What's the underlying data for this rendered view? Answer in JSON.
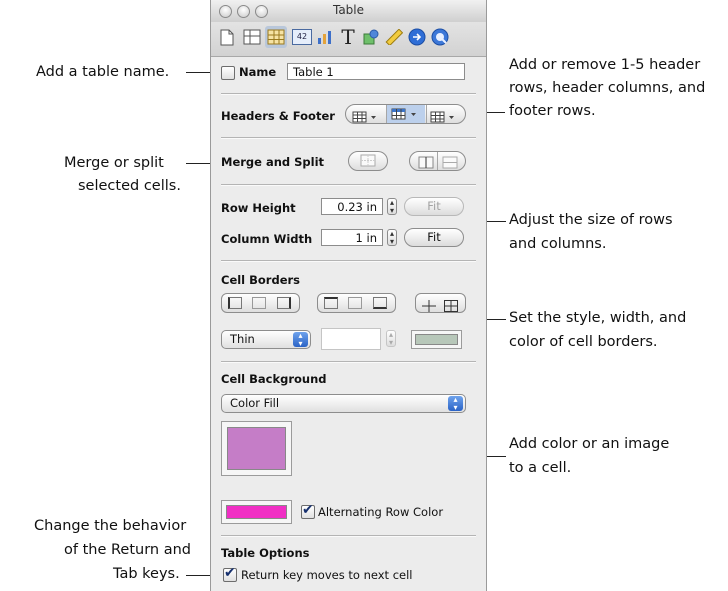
{
  "window": {
    "title": "Table"
  },
  "toolbar": {
    "icons": [
      "document-icon",
      "layout-icon",
      "table-icon",
      "graph-icon",
      "chart-icon",
      "text-icon",
      "shape-icon",
      "metrics-icon",
      "hyperlink-icon",
      "quicktime-icon"
    ],
    "graph_label": "42",
    "text_label": "T"
  },
  "name_row": {
    "label": "Name",
    "value": "Table 1"
  },
  "headers_footer": {
    "label": "Headers & Footer"
  },
  "merge_split": {
    "label": "Merge and Split"
  },
  "row_height": {
    "label": "Row Height",
    "value": "0.23 in",
    "fit_label": "Fit"
  },
  "column_width": {
    "label": "Column Width",
    "value": "1 in",
    "fit_label": "Fit"
  },
  "cell_borders": {
    "label": "Cell Borders",
    "style_value": "Thin",
    "width_value": "",
    "color": "#b7c7b9"
  },
  "cell_background": {
    "label": "Cell Background",
    "fill_value": "Color Fill",
    "fill_color": "#c57dc7",
    "alt_row_color": "#f02fc4",
    "alt_row_label": "Alternating Row Color"
  },
  "table_options": {
    "label": "Table Options",
    "return_key_label": "Return key moves to next cell"
  },
  "callouts": {
    "name": "Add a table name.",
    "headers_1": "Add or remove 1-5 header",
    "headers_2": "rows, header columns, and",
    "headers_3": "footer rows.",
    "merge_1": "Merge or split",
    "merge_2": "selected cells.",
    "size_1": "Adjust the size of rows",
    "size_2": "and columns.",
    "borders_1": "Set the style, width, and",
    "borders_2": "color of cell borders.",
    "background_1": "Add color or an image",
    "background_2": "to a cell.",
    "return_1": "Change the behavior",
    "return_2": "of the Return and",
    "return_3": "Tab keys."
  }
}
